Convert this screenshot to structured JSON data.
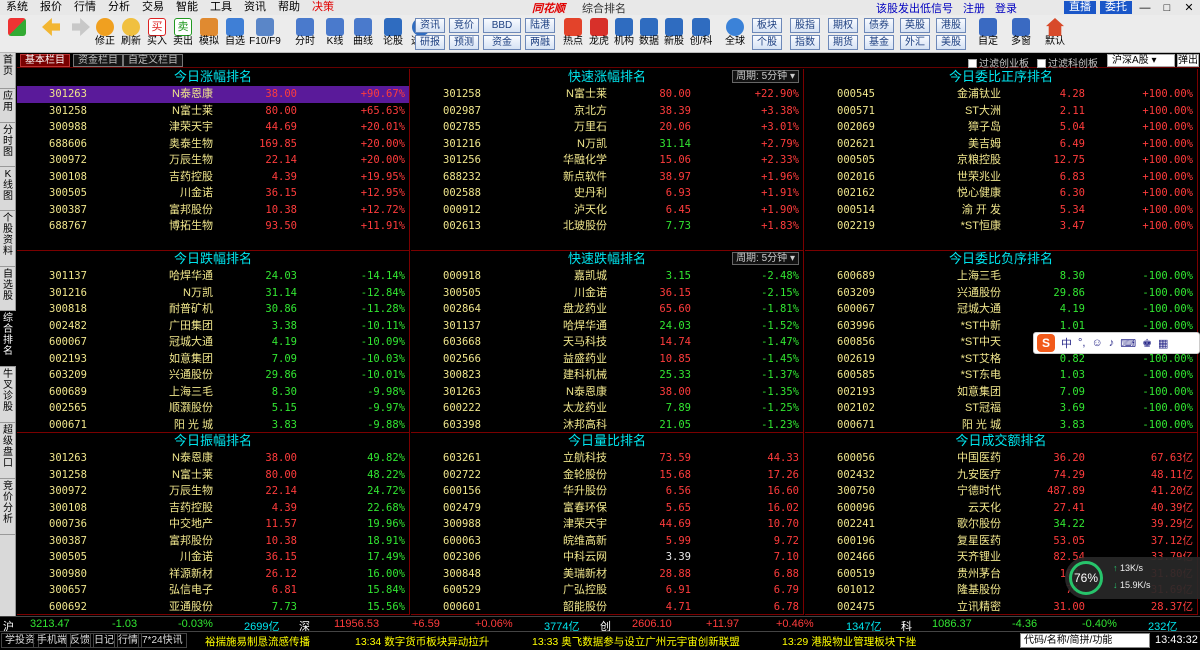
{
  "menu": {
    "items": [
      "系统",
      "报价",
      "行情",
      "分析",
      "交易",
      "智能",
      "工具",
      "资讯",
      "帮助"
    ],
    "highlight": "决策",
    "brand": "同花顺",
    "window_title": "综合排名",
    "right_links": [
      "该股发出低信号",
      "注册",
      "登录"
    ],
    "right_blocks": [
      "直播",
      "委托"
    ],
    "window_buttons": [
      "—",
      "□",
      "✕"
    ]
  },
  "toolbar": {
    "left_buttons": [
      "修正",
      "刷新",
      "买入",
      "卖出",
      "模拟",
      "自选",
      "F10/F9",
      "分时",
      "K线",
      "曲线",
      "论股",
      "选股"
    ],
    "box_top": [
      "资讯",
      "竞价",
      "BBD",
      "陆港"
    ],
    "box_bottom": [
      "研报",
      "预测",
      "资金",
      "两融"
    ],
    "mid_buttons": [
      "热点",
      "龙虎",
      "机构",
      "数据",
      "新股",
      "创/科",
      "全球"
    ],
    "box2_top": [
      "板块",
      "股指",
      "期权",
      "债券",
      "英股",
      "港股"
    ],
    "box2_bottom": [
      "个股",
      "指数",
      "期货",
      "基金",
      "外汇",
      "美股"
    ],
    "right_buttons": [
      "自定",
      "多窗",
      "默认"
    ]
  },
  "left_tabs": [
    "首页",
    "应用",
    "分时图",
    "K线图",
    "个股资料",
    "自选股",
    "综合排名",
    "牛叉诊股",
    "超级盘口",
    "竞价分析"
  ],
  "tabstrip": {
    "tabs": [
      "基本栏目",
      "资金栏目",
      "自定义栏目"
    ],
    "filters": [
      "过滤创业板",
      "过滤科创板"
    ],
    "market": "沪深A股",
    "popup": "弹出"
  },
  "panels": [
    {
      "title": "今日涨幅排名",
      "rows": [
        {
          "code": "301263",
          "name": "N泰恩康",
          "price": "38.00",
          "value": "+90.67%",
          "pc": "red",
          "vc": "red"
        },
        {
          "code": "301258",
          "name": "N富士莱",
          "price": "80.00",
          "value": "+65.63%",
          "pc": "red",
          "vc": "red"
        },
        {
          "code": "300988",
          "name": "津荣天宇",
          "price": "44.69",
          "value": "+20.01%",
          "pc": "red",
          "vc": "red"
        },
        {
          "code": "688606",
          "name": "奥泰生物",
          "price": "169.85",
          "value": "+20.00%",
          "pc": "red",
          "vc": "red"
        },
        {
          "code": "300972",
          "name": "万辰生物",
          "price": "22.14",
          "value": "+20.00%",
          "pc": "red",
          "vc": "red"
        },
        {
          "code": "300108",
          "name": "吉药控股",
          "price": "4.39",
          "value": "+19.95%",
          "pc": "red",
          "vc": "red"
        },
        {
          "code": "300505",
          "name": "川金诺",
          "price": "36.15",
          "value": "+12.95%",
          "pc": "red",
          "vc": "red"
        },
        {
          "code": "300387",
          "name": "富邦股份",
          "price": "10.38",
          "value": "+12.72%",
          "pc": "red",
          "vc": "red"
        },
        {
          "code": "688767",
          "name": "博拓生物",
          "price": "93.50",
          "value": "+11.91%",
          "pc": "red",
          "vc": "red"
        }
      ]
    },
    {
      "title": "快速涨幅排名",
      "period": "周期: 5分钟",
      "rows": [
        {
          "code": "301258",
          "name": "N富士莱",
          "price": "80.00",
          "value": "+22.90%",
          "pc": "red",
          "vc": "red"
        },
        {
          "code": "002987",
          "name": "京北方",
          "price": "38.39",
          "value": "+3.38%",
          "pc": "red",
          "vc": "red"
        },
        {
          "code": "002785",
          "name": "万里石",
          "price": "20.06",
          "value": "+3.01%",
          "pc": "red",
          "vc": "red"
        },
        {
          "code": "301216",
          "name": "N万凯",
          "price": "31.14",
          "value": "+2.79%",
          "pc": "grn",
          "vc": "red"
        },
        {
          "code": "301256",
          "name": "华融化学",
          "price": "15.06",
          "value": "+2.33%",
          "pc": "red",
          "vc": "red"
        },
        {
          "code": "688232",
          "name": "新点软件",
          "price": "38.97",
          "value": "+1.96%",
          "pc": "red",
          "vc": "red"
        },
        {
          "code": "002588",
          "name": "史丹利",
          "price": "6.93",
          "value": "+1.91%",
          "pc": "red",
          "vc": "red"
        },
        {
          "code": "000912",
          "name": "泸天化",
          "price": "6.45",
          "value": "+1.90%",
          "pc": "red",
          "vc": "red"
        },
        {
          "code": "002613",
          "name": "北玻股份",
          "price": "7.73",
          "value": "+1.83%",
          "pc": "grn",
          "vc": "red"
        }
      ]
    },
    {
      "title": "今日委比正序排名",
      "rows": [
        {
          "code": "000545",
          "name": "金浦钛业",
          "price": "4.28",
          "value": "+100.00%",
          "pc": "red",
          "vc": "red"
        },
        {
          "code": "000571",
          "name": "ST大洲",
          "price": "2.11",
          "value": "+100.00%",
          "pc": "red",
          "vc": "red"
        },
        {
          "code": "002069",
          "name": "獐子岛",
          "price": "5.04",
          "value": "+100.00%",
          "pc": "red",
          "vc": "red"
        },
        {
          "code": "002621",
          "name": "美吉姆",
          "price": "6.49",
          "value": "+100.00%",
          "pc": "red",
          "vc": "red"
        },
        {
          "code": "000505",
          "name": "京粮控股",
          "price": "12.75",
          "value": "+100.00%",
          "pc": "red",
          "vc": "red"
        },
        {
          "code": "002016",
          "name": "世荣兆业",
          "price": "6.83",
          "value": "+100.00%",
          "pc": "red",
          "vc": "red"
        },
        {
          "code": "002162",
          "name": "悦心健康",
          "price": "6.30",
          "value": "+100.00%",
          "pc": "red",
          "vc": "red"
        },
        {
          "code": "000514",
          "name": "渝 开 发",
          "price": "5.34",
          "value": "+100.00%",
          "pc": "red",
          "vc": "red"
        },
        {
          "code": "002219",
          "name": "*ST恒康",
          "price": "3.47",
          "value": "+100.00%",
          "pc": "red",
          "vc": "red"
        }
      ]
    },
    {
      "title": "今日跌幅排名",
      "rows": [
        {
          "code": "301137",
          "name": "哈焊华通",
          "price": "24.03",
          "value": "-14.14%",
          "pc": "grn",
          "vc": "grn"
        },
        {
          "code": "301216",
          "name": "N万凯",
          "price": "31.14",
          "value": "-12.84%",
          "pc": "grn",
          "vc": "grn"
        },
        {
          "code": "300818",
          "name": "耐普矿机",
          "price": "30.86",
          "value": "-11.28%",
          "pc": "grn",
          "vc": "grn"
        },
        {
          "code": "002482",
          "name": "广田集团",
          "price": "3.38",
          "value": "-10.11%",
          "pc": "grn",
          "vc": "grn"
        },
        {
          "code": "600067",
          "name": "冠城大通",
          "price": "4.19",
          "value": "-10.09%",
          "pc": "grn",
          "vc": "grn"
        },
        {
          "code": "002193",
          "name": "如意集团",
          "price": "7.09",
          "value": "-10.03%",
          "pc": "grn",
          "vc": "grn"
        },
        {
          "code": "603209",
          "name": "兴通股份",
          "price": "29.86",
          "value": "-10.01%",
          "pc": "grn",
          "vc": "grn"
        },
        {
          "code": "600689",
          "name": "上海三毛",
          "price": "8.30",
          "value": "-9.98%",
          "pc": "grn",
          "vc": "grn"
        },
        {
          "code": "002565",
          "name": "顺灏股份",
          "price": "5.15",
          "value": "-9.97%",
          "pc": "grn",
          "vc": "grn"
        },
        {
          "code": "000671",
          "name": "阳 光 城",
          "price": "3.83",
          "value": "-9.88%",
          "pc": "grn",
          "vc": "grn"
        }
      ]
    },
    {
      "title": "快速跌幅排名",
      "period": "周期: 5分钟",
      "rows": [
        {
          "code": "000918",
          "name": "嘉凯城",
          "price": "3.15",
          "value": "-2.48%",
          "pc": "grn",
          "vc": "grn"
        },
        {
          "code": "300505",
          "name": "川金诺",
          "price": "36.15",
          "value": "-2.15%",
          "pc": "red",
          "vc": "grn"
        },
        {
          "code": "002864",
          "name": "盘龙药业",
          "price": "65.60",
          "value": "-1.81%",
          "pc": "red",
          "vc": "grn"
        },
        {
          "code": "301137",
          "name": "哈焊华通",
          "price": "24.03",
          "value": "-1.52%",
          "pc": "grn",
          "vc": "grn"
        },
        {
          "code": "603668",
          "name": "天马科技",
          "price": "14.74",
          "value": "-1.47%",
          "pc": "red",
          "vc": "grn"
        },
        {
          "code": "002566",
          "name": "益盛药业",
          "price": "10.85",
          "value": "-1.45%",
          "pc": "red",
          "vc": "grn"
        },
        {
          "code": "300823",
          "name": "建科机械",
          "price": "25.33",
          "value": "-1.37%",
          "pc": "grn",
          "vc": "grn"
        },
        {
          "code": "301263",
          "name": "N泰恩康",
          "price": "38.00",
          "value": "-1.35%",
          "pc": "red",
          "vc": "grn"
        },
        {
          "code": "600222",
          "name": "太龙药业",
          "price": "7.89",
          "value": "-1.25%",
          "pc": "grn",
          "vc": "grn"
        },
        {
          "code": "603398",
          "name": "沐邦高科",
          "price": "21.05",
          "value": "-1.23%",
          "pc": "grn",
          "vc": "grn"
        }
      ]
    },
    {
      "title": "今日委比负序排名",
      "rows": [
        {
          "code": "600689",
          "name": "上海三毛",
          "price": "8.30",
          "value": "-100.00%",
          "pc": "grn",
          "vc": "grn"
        },
        {
          "code": "603209",
          "name": "兴通股份",
          "price": "29.86",
          "value": "-100.00%",
          "pc": "grn",
          "vc": "grn"
        },
        {
          "code": "600067",
          "name": "冠城大通",
          "price": "4.19",
          "value": "-100.00%",
          "pc": "grn",
          "vc": "grn"
        },
        {
          "code": "603996",
          "name": "*ST中新",
          "price": "1.01",
          "value": "-100.00%",
          "pc": "grn",
          "vc": "grn"
        },
        {
          "code": "600856",
          "name": "*ST中天",
          "price": "1.02",
          "value": "-100.00%",
          "pc": "grn",
          "vc": "grn"
        },
        {
          "code": "002619",
          "name": "*ST艾格",
          "price": "0.82",
          "value": "-100.00%",
          "pc": "grn",
          "vc": "grn"
        },
        {
          "code": "600585",
          "name": "*ST东电",
          "price": "1.03",
          "value": "-100.00%",
          "pc": "grn",
          "vc": "grn"
        },
        {
          "code": "002193",
          "name": "如意集团",
          "price": "7.09",
          "value": "-100.00%",
          "pc": "grn",
          "vc": "grn"
        },
        {
          "code": "002102",
          "name": "ST冠福",
          "price": "3.69",
          "value": "-100.00%",
          "pc": "grn",
          "vc": "grn"
        },
        {
          "code": "000671",
          "name": "阳 光 城",
          "price": "3.83",
          "value": "-100.00%",
          "pc": "grn",
          "vc": "grn"
        }
      ]
    },
    {
      "title": "今日振幅排名",
      "rows": [
        {
          "code": "301263",
          "name": "N泰恩康",
          "price": "38.00",
          "value": "49.82%",
          "pc": "red",
          "vc": "grn"
        },
        {
          "code": "301258",
          "name": "N富士莱",
          "price": "80.00",
          "value": "48.22%",
          "pc": "red",
          "vc": "grn"
        },
        {
          "code": "300972",
          "name": "万辰生物",
          "price": "22.14",
          "value": "24.72%",
          "pc": "red",
          "vc": "grn"
        },
        {
          "code": "300108",
          "name": "吉药控股",
          "price": "4.39",
          "value": "22.68%",
          "pc": "red",
          "vc": "grn"
        },
        {
          "code": "000736",
          "name": "中交地产",
          "price": "11.57",
          "value": "19.96%",
          "pc": "red",
          "vc": "grn"
        },
        {
          "code": "300387",
          "name": "富邦股份",
          "price": "10.38",
          "value": "18.91%",
          "pc": "red",
          "vc": "grn"
        },
        {
          "code": "300505",
          "name": "川金诺",
          "price": "36.15",
          "value": "17.49%",
          "pc": "red",
          "vc": "grn"
        },
        {
          "code": "300980",
          "name": "祥源新材",
          "price": "26.12",
          "value": "16.00%",
          "pc": "red",
          "vc": "grn"
        },
        {
          "code": "300657",
          "name": "弘信电子",
          "price": "6.81",
          "value": "15.84%",
          "pc": "red",
          "vc": "grn"
        },
        {
          "code": "600692",
          "name": "亚通股份",
          "price": "7.73",
          "value": "15.56%",
          "pc": "grn",
          "vc": "grn"
        }
      ]
    },
    {
      "title": "今日量比排名",
      "rows": [
        {
          "code": "603261",
          "name": "立航科技",
          "price": "73.59",
          "value": "44.33",
          "pc": "red",
          "vc": "red"
        },
        {
          "code": "002722",
          "name": "金轮股份",
          "price": "15.68",
          "value": "17.26",
          "pc": "red",
          "vc": "red"
        },
        {
          "code": "600156",
          "name": "华升股份",
          "price": "6.56",
          "value": "16.60",
          "pc": "red",
          "vc": "red"
        },
        {
          "code": "002479",
          "name": "富春环保",
          "price": "5.65",
          "value": "16.02",
          "pc": "red",
          "vc": "red"
        },
        {
          "code": "300988",
          "name": "津荣天宇",
          "price": "44.69",
          "value": "10.70",
          "pc": "red",
          "vc": "red"
        },
        {
          "code": "600063",
          "name": "皖维高新",
          "price": "5.99",
          "value": "9.72",
          "pc": "red",
          "vc": "red"
        },
        {
          "code": "002306",
          "name": "中科云网",
          "price": "3.39",
          "value": "7.10",
          "pc": "wht",
          "vc": "red"
        },
        {
          "code": "300848",
          "name": "美瑞新材",
          "price": "28.88",
          "value": "6.88",
          "pc": "red",
          "vc": "red"
        },
        {
          "code": "600529",
          "name": "广弘控股",
          "price": "6.91",
          "value": "6.79",
          "pc": "red",
          "vc": "red"
        },
        {
          "code": "000601",
          "name": "韶能股份",
          "price": "4.71",
          "value": "6.78",
          "pc": "red",
          "vc": "red"
        }
      ]
    },
    {
      "title": "今日成交额排名",
      "rows": [
        {
          "code": "600056",
          "name": "中国医药",
          "price": "36.20",
          "value": "67.63亿",
          "pc": "red",
          "vc": "red"
        },
        {
          "code": "002432",
          "name": "九安医疗",
          "price": "74.29",
          "value": "48.11亿",
          "pc": "red",
          "vc": "red"
        },
        {
          "code": "300750",
          "name": "宁德时代",
          "price": "487.89",
          "value": "41.20亿",
          "pc": "red",
          "vc": "red"
        },
        {
          "code": "600096",
          "name": "云天化",
          "price": "27.41",
          "value": "40.39亿",
          "pc": "red",
          "vc": "red"
        },
        {
          "code": "002241",
          "name": "歌尔股份",
          "price": "34.22",
          "value": "39.29亿",
          "pc": "grn",
          "vc": "red"
        },
        {
          "code": "600196",
          "name": "复星医药",
          "price": "53.05",
          "value": "37.12亿",
          "pc": "red",
          "vc": "red"
        },
        {
          "code": "002466",
          "name": "天齐锂业",
          "price": "82.54",
          "value": "33.79亿",
          "pc": "red",
          "vc": "red"
        },
        {
          "code": "600519",
          "name": "贵州茅台",
          "price": "167…",
          "value": "31.80亿",
          "pc": "red",
          "vc": "red"
        },
        {
          "code": "601012",
          "name": "隆基股份",
          "price": "74…",
          "value": "31.69亿",
          "pc": "red",
          "vc": "red"
        },
        {
          "code": "002475",
          "name": "立讯精密",
          "price": "31.00",
          "value": "28.37亿",
          "pc": "red",
          "vc": "red"
        }
      ]
    }
  ],
  "selected_row": {
    "panel": 0,
    "row": 0
  },
  "index_bar": {
    "sh": {
      "label": "沪",
      "value": "3213.47",
      "change": "-1.03",
      "pct": "-0.03%",
      "amount": "2699亿"
    },
    "sz": {
      "label": "深",
      "value": "11956.53",
      "change": "+6.59",
      "pct": "+0.06%",
      "amount": "3774亿"
    },
    "cy": {
      "label": "创",
      "value": "2606.10",
      "change": "+11.97",
      "pct": "+0.46%",
      "amount": "1347亿"
    },
    "kc": {
      "label": "科",
      "value": "1086.37",
      "change": "-4.36",
      "pct": "-0.40%",
      "amount": "232亿"
    }
  },
  "status_bar": {
    "buttons": [
      "学投资",
      "手机端",
      "反馈",
      "日记",
      "行情",
      "7*24快讯"
    ],
    "news": [
      "裕揣施易制恳流感传播",
      "13:34 数字货币板块异动拉升",
      "13:33 奥飞数据参与设立广州元宇宙创新联盟",
      "13:29 港股物业管理板块下挫"
    ],
    "search_placeholder": "代码/名称/简拼/功能",
    "clock": "13:43:32"
  },
  "widgets": {
    "ime_label": "中",
    "net_percent": "76%",
    "net_up": "13K/s",
    "net_down": "15.9K/s"
  },
  "colors": {
    "up": "#ff3c3c",
    "down": "#32e632",
    "title": "#00e5ee",
    "name": "#f0e68c",
    "selected": "#5a1a9a"
  }
}
